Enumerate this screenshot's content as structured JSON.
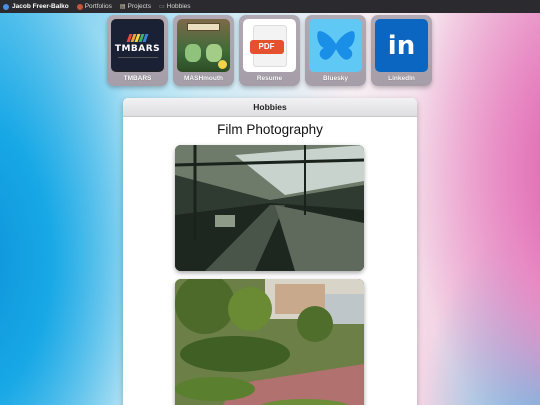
{
  "topbar": {
    "brand": "Jacob Freer-Balko",
    "nav": [
      {
        "label": "Portfolios",
        "icon": "portfolio-icon"
      },
      {
        "label": "Projects",
        "icon": "clipboard-icon"
      },
      {
        "label": "Hobbies",
        "icon": "gamepad-icon"
      }
    ]
  },
  "tiles": [
    {
      "label": "TMBARS",
      "icon": "tmbars-logo",
      "logo_text": "TMBARS"
    },
    {
      "label": "MASHmouth",
      "icon": "mashmouth-logo"
    },
    {
      "label": "Resume",
      "icon": "pdf-icon",
      "badge": "PDF"
    },
    {
      "label": "Bluesky",
      "icon": "butterfly-icon"
    },
    {
      "label": "LinkedIn",
      "icon": "linkedin-icon",
      "logo_text": "in"
    }
  ],
  "panel": {
    "header": "Hobbies",
    "section_title": "Film Photography",
    "photos": [
      {
        "subject": "train-station-photo"
      },
      {
        "subject": "hillside-garden-photo"
      }
    ]
  },
  "colors": {
    "topbar_bg": "#2b2b2f",
    "tile_bg": "#aaa2ac",
    "linkedin_blue": "#0b66c2",
    "bluesky_blue": "#60c8f4",
    "pdf_red": "#e5502f"
  }
}
